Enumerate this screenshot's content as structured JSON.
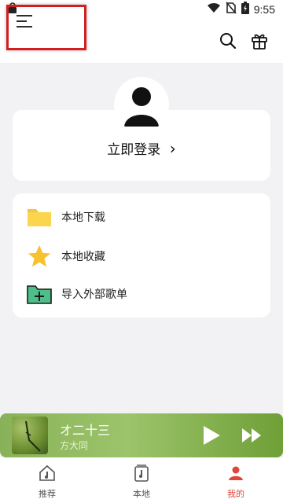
{
  "status_bar": {
    "time": "9:55",
    "icons": [
      "lock-icon",
      "wifi-icon",
      "no-sim-icon",
      "battery-charging-icon"
    ]
  },
  "top_bar": {
    "menu_icon": "menu-icon",
    "search_icon": "search-icon",
    "gift_icon": "gift-icon",
    "highlight_color": "#d22020"
  },
  "profile": {
    "login_label": "立即登录",
    "chevron": "›"
  },
  "menu": {
    "items": [
      {
        "label": "本地下载",
        "icon": "folder-icon"
      },
      {
        "label": "本地收藏",
        "icon": "star-icon"
      },
      {
        "label": "导入外部歌单",
        "icon": "import-playlist-icon"
      }
    ]
  },
  "player": {
    "title": "オ二十三",
    "artist": "方大同"
  },
  "bottom_nav": {
    "tabs": [
      {
        "label": "推荐",
        "icon": "home-music-icon",
        "active": false
      },
      {
        "label": "本地",
        "icon": "local-music-icon",
        "active": false
      },
      {
        "label": "我的",
        "icon": "profile-icon",
        "active": true
      }
    ],
    "active_color": "#e0453a"
  }
}
